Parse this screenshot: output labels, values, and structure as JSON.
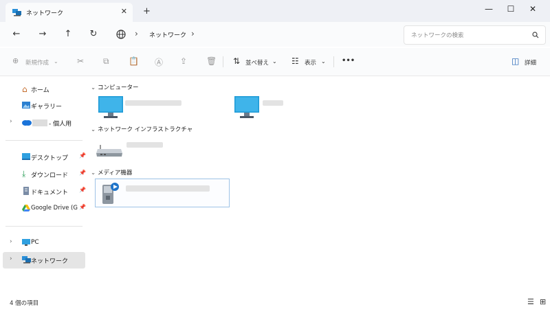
{
  "tab": {
    "title": "ネットワーク",
    "close": "✕",
    "new_tab": "+"
  },
  "window_controls": {
    "minimize": "—",
    "maximize": "☐",
    "close": "✕"
  },
  "nav": {
    "back": "←",
    "forward": "→",
    "up": "↑",
    "refresh": "↻",
    "separator": "›",
    "location": "ネットワーク",
    "next": "›"
  },
  "search": {
    "placeholder": "ネットワークの検索"
  },
  "toolbar": {
    "new_label": "新規作成",
    "sort_label": "並べ替え",
    "view_label": "表示",
    "more_label": "•••",
    "details_label": "詳細"
  },
  "sidebar": {
    "items": [
      {
        "label": "ホーム"
      },
      {
        "label": "ギャラリー"
      },
      {
        "label": "- 個人用"
      },
      {
        "label": "デスクトップ"
      },
      {
        "label": "ダウンロード"
      },
      {
        "label": "ドキュメント"
      },
      {
        "label": "Google Drive (G"
      },
      {
        "label": "PC"
      },
      {
        "label": "ネットワーク"
      }
    ]
  },
  "groups": [
    {
      "label": "コンピューター"
    },
    {
      "label": "ネットワーク インフラストラクチャ"
    },
    {
      "label": "メディア機器"
    }
  ],
  "status": {
    "count": "4 個の項目"
  },
  "colors": {
    "selected_bg": "#e5e5e5",
    "accent": "#0067c0",
    "monitor": "#1e9ad6"
  }
}
